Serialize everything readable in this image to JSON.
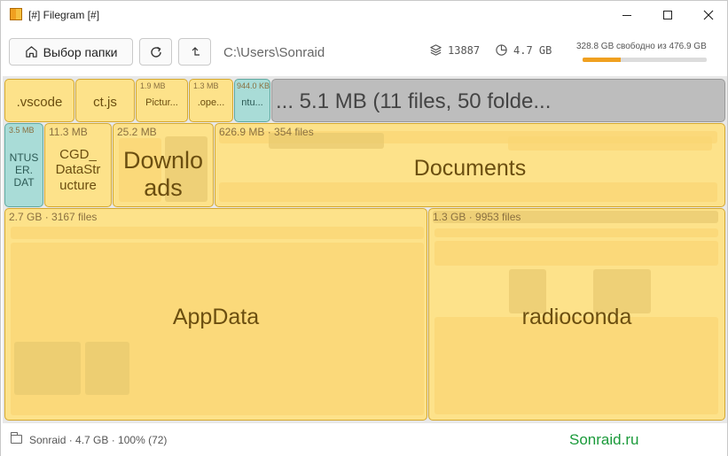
{
  "window": {
    "title": "[#] Filegram [#]",
    "icons": {
      "minimize": "minimize-icon",
      "maximize": "maximize-icon",
      "close": "close-icon"
    }
  },
  "toolbar": {
    "folder_button_label": "Выбор папки",
    "path": "C:\\Users\\Sonraid",
    "files_count": "13887",
    "total_size": "4.7 GB",
    "disk_label": "328.8 GB свободно из 476.9 GB",
    "disk_used_fraction": 0.31
  },
  "treemap": {
    "cells": {
      "vscode": {
        "label": ".vscode"
      },
      "ctjs": {
        "label": "ct.js"
      },
      "pictures": {
        "meta": "1.9 MB",
        "label": "Pictur..."
      },
      "ope": {
        "meta": "1.3 MB",
        "label": ".ope..."
      },
      "ntu": {
        "meta": "944.0 KB",
        "label": "ntu..."
      },
      "more": {
        "label": "... 5.1 MB (11 files, 50 folde..."
      },
      "ntuser": {
        "meta": "3.5 MB",
        "label": "NTUS ER. DAT"
      },
      "cgd": {
        "meta": "11.3 MB",
        "label": "CGD_ DataStr ucture"
      },
      "downloads": {
        "meta": "25.2 MB",
        "label": "Downlo ads"
      },
      "documents": {
        "meta": "626.9 MB · 354 files",
        "label": "Documents"
      },
      "appdata": {
        "meta": "2.7 GB · 3167 files",
        "label": "AppData"
      },
      "radioconda": {
        "meta": "1.3 GB · 9953 files",
        "label": "radioconda"
      }
    },
    "colors": {
      "folder": "#fde28a",
      "more": "#bdbdbd",
      "file": "#a9dcd7"
    }
  },
  "status": {
    "text": "Sonraid · 4.7 GB · 100% (72)",
    "brand": "Sonraid.ru"
  }
}
